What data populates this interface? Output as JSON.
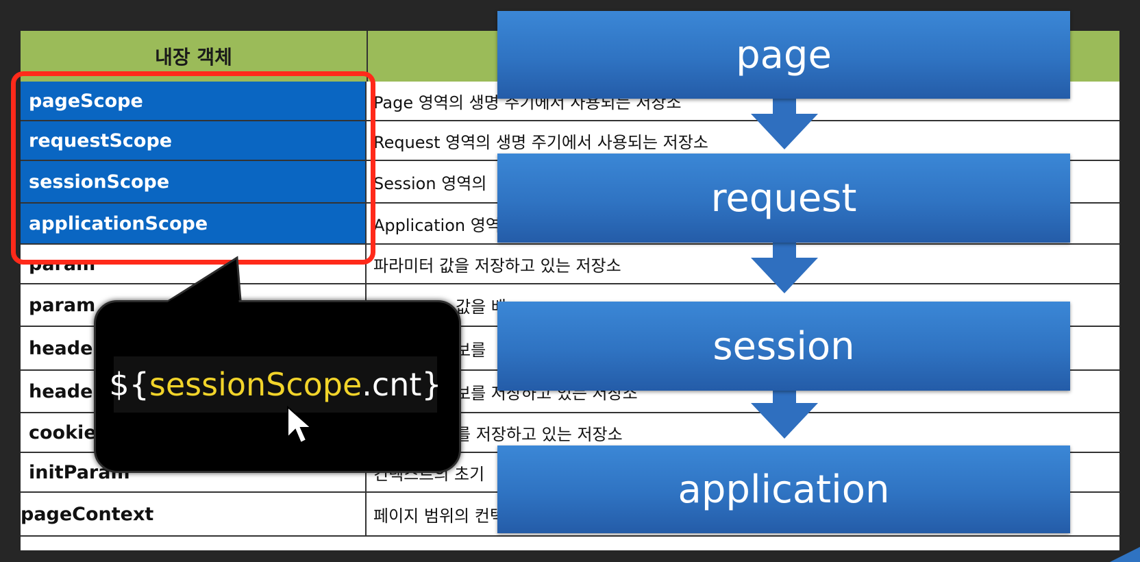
{
  "table": {
    "header": "내장 객체",
    "rows": [
      {
        "name": "pageScope",
        "desc": "Page 영역의 생명 주기에서 사용되는 저장소"
      },
      {
        "name": "requestScope",
        "desc": "Request 영역의 생명 주기에서 사용되는 저장소"
      },
      {
        "name": "sessionScope",
        "desc": "Session 영역의"
      },
      {
        "name": "applicationScope",
        "desc": "Application 영역"
      },
      {
        "name": "param",
        "desc": "파라미터 값을 저장하고 있는 저장소"
      },
      {
        "name": "param",
        "desc": "값을 배"
      },
      {
        "name": "heade",
        "desc": "보를"
      },
      {
        "name": "heade",
        "desc": "보를 저장하고 있는 저장소"
      },
      {
        "name": "cookie",
        "desc": "를 저장하고 있는 저장소"
      },
      {
        "name": "initParam",
        "desc": "컨텍스트의 초기"
      },
      {
        "name": "pageContext",
        "desc": "페이지 범위의 컨텍스트 저장소"
      }
    ]
  },
  "callout": {
    "prefix": "${",
    "key": "sessionScope",
    "suffix": ".cnt}"
  },
  "flow": [
    "page",
    "request",
    "session",
    "application"
  ],
  "colors": {
    "header_green": "#9bbb59",
    "scope_blue": "#0a66c2",
    "highlight_red": "#ff2a1a",
    "flow_blue": "#2f73c2",
    "expr_yellow": "#f2d42a"
  },
  "icons": [
    "mouse-pointer-icon",
    "down-arrow-icon"
  ]
}
